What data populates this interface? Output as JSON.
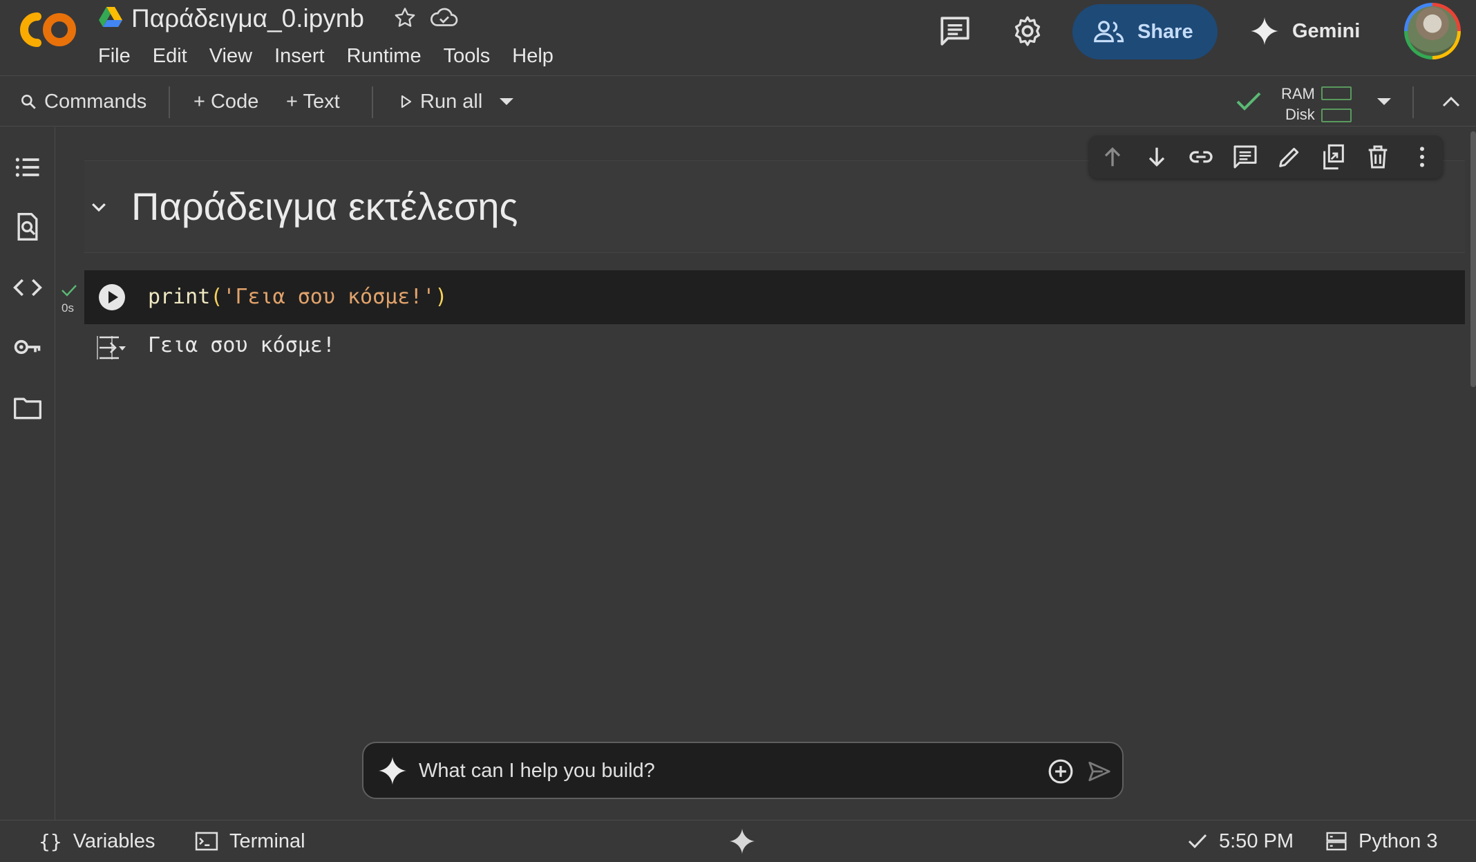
{
  "header": {
    "logo": "colab-logo",
    "title": "Παράδειγμα_0.ipynb",
    "menu": [
      "File",
      "Edit",
      "View",
      "Insert",
      "Runtime",
      "Tools",
      "Help"
    ],
    "share_label": "Share",
    "gemini_label": "Gemini",
    "colors": {
      "share_bg": "#1e4a78",
      "logo_orange": "#f9ab00"
    }
  },
  "toolbar": {
    "commands_label": "Commands",
    "code_label": "+ Code",
    "text_label": "+ Text",
    "run_all_label": "Run all",
    "ram_label": "RAM",
    "disk_label": "Disk",
    "connected": true
  },
  "sidebar": {
    "icons": [
      "table-of-contents-icon",
      "find-replace-icon",
      "code-snippets-icon",
      "secrets-key-icon",
      "files-folder-icon"
    ]
  },
  "notebook": {
    "cell_toolbar_icons": [
      "move-up-icon",
      "move-down-icon",
      "link-icon",
      "comment-icon",
      "edit-icon",
      "mirror-cell-icon",
      "delete-icon",
      "more-options-icon"
    ],
    "heading": "Παράδειγμα εκτέλεσης",
    "code": {
      "fn": "print",
      "open_paren": "(",
      "string": "'Γεια σου κόσμε!'",
      "close_paren": ")"
    },
    "exec_time": "0s",
    "output": "Γεια σου κόσμε!"
  },
  "prompt": {
    "placeholder": "What can I help you build?"
  },
  "statusbar": {
    "variables_label": "Variables",
    "terminal_label": "Terminal",
    "time": "5:50 PM",
    "runtime": "Python 3"
  }
}
